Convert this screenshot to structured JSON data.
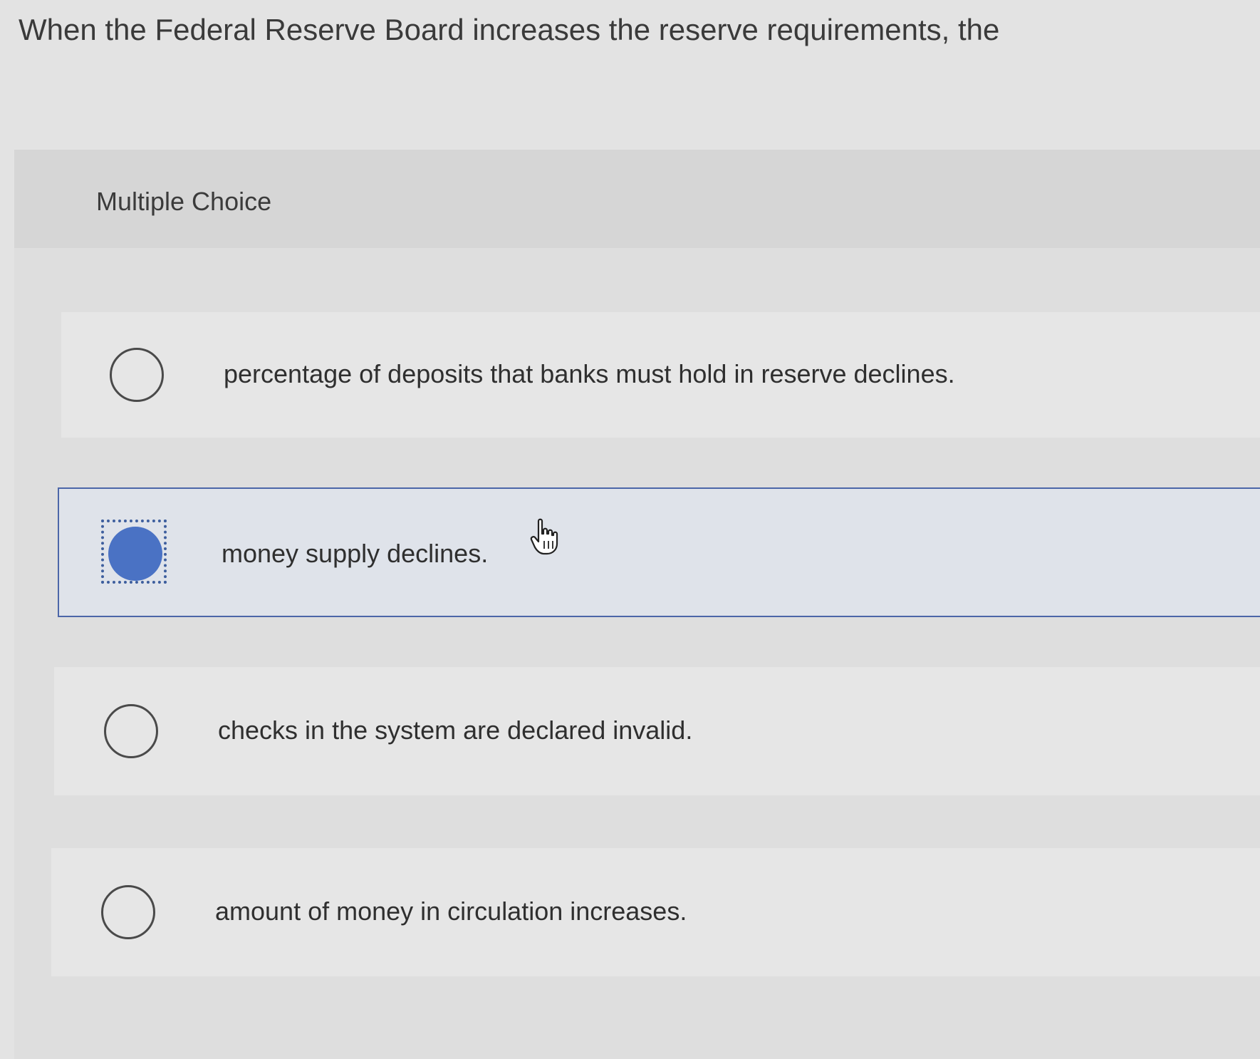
{
  "question": {
    "text": "When the Federal Reserve Board increases the reserve requirements, the"
  },
  "panel": {
    "label": "Multiple Choice"
  },
  "choices": [
    {
      "text": "percentage of deposits that banks must hold in reserve declines.",
      "selected": false
    },
    {
      "text": "money supply declines.",
      "selected": true
    },
    {
      "text": "checks in the system are declared invalid.",
      "selected": false
    },
    {
      "text": "amount of money in circulation increases.",
      "selected": false
    }
  ],
  "cursor": {
    "icon": "hand-pointer-icon"
  },
  "colors": {
    "accent": "#4a72c4",
    "selected_border": "#4c66a8",
    "selected_background": "#dfe3ea"
  }
}
